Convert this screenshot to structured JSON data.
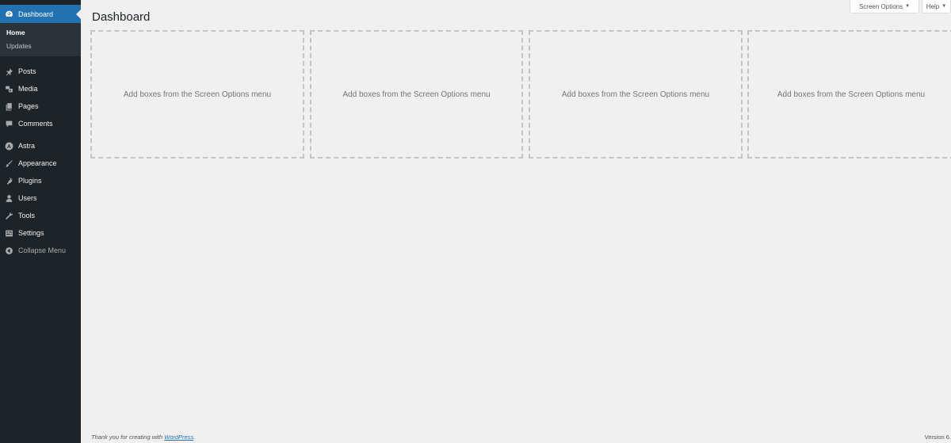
{
  "sidebar": {
    "current": {
      "label": "Dashboard",
      "icon": "dashboard-icon"
    },
    "submenu": [
      {
        "label": "Home"
      },
      {
        "label": "Updates"
      }
    ],
    "items": [
      {
        "label": "Posts",
        "icon": "pin-icon"
      },
      {
        "label": "Media",
        "icon": "media-icon"
      },
      {
        "label": "Pages",
        "icon": "pages-icon"
      },
      {
        "label": "Comments",
        "icon": "comment-icon"
      },
      {
        "label": "Astra",
        "icon": "astra-icon"
      },
      {
        "label": "Appearance",
        "icon": "brush-icon"
      },
      {
        "label": "Plugins",
        "icon": "plug-icon"
      },
      {
        "label": "Users",
        "icon": "user-icon"
      },
      {
        "label": "Tools",
        "icon": "wrench-icon"
      },
      {
        "label": "Settings",
        "icon": "settings-icon"
      }
    ],
    "collapse": {
      "label": "Collapse Menu",
      "icon": "collapse-icon"
    }
  },
  "header": {
    "title": "Dashboard",
    "screen_options": "Screen Options",
    "help": "Help"
  },
  "boxes": [
    {
      "text": "Add boxes from the Screen Options menu"
    },
    {
      "text": "Add boxes from the Screen Options menu"
    },
    {
      "text": "Add boxes from the Screen Options menu"
    },
    {
      "text": "Add boxes from the Screen Options menu"
    }
  ],
  "footer": {
    "thanks": "Thank you for creating with",
    "link": "WordPress",
    "period": ".",
    "version": "Version 6."
  },
  "colors": {
    "sidebar_bg": "#1d2327",
    "accent": "#2271b1",
    "page_bg": "#f0f0f1"
  }
}
